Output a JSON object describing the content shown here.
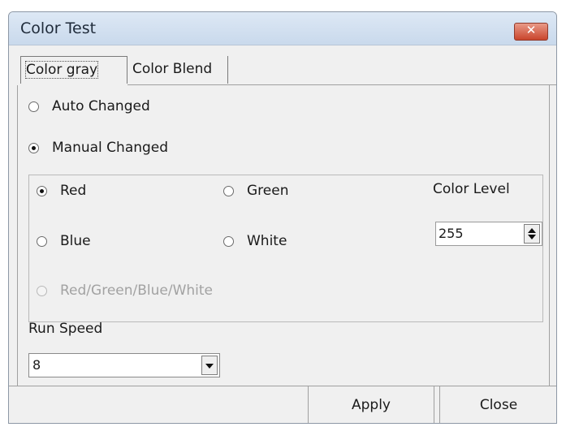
{
  "window": {
    "title": "Color Test"
  },
  "tabs": [
    {
      "label": "Color gray",
      "selected": true
    },
    {
      "label": "Color Blend",
      "selected": false
    }
  ],
  "mode": {
    "auto_label": "Auto Changed",
    "manual_label": "Manual Changed",
    "selected": "Manual Changed"
  },
  "colors": {
    "red": "Red",
    "green": "Green",
    "blue": "Blue",
    "white": "White",
    "cycle": "Red/Green/Blue/White",
    "selected": "Red",
    "cycle_disabled": true
  },
  "color_level": {
    "label": "Color Level",
    "value": "255"
  },
  "run_speed": {
    "label": "Run Speed",
    "value": "8"
  },
  "buttons": {
    "apply": "Apply",
    "close": "Close"
  }
}
